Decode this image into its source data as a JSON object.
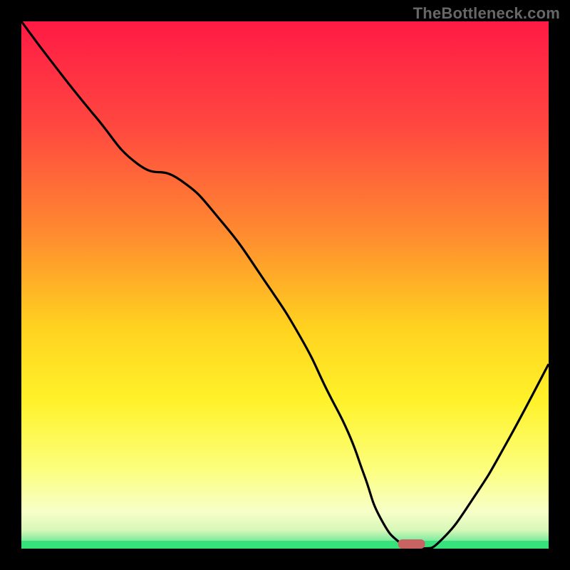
{
  "watermark": "TheBottleneck.com",
  "colors": {
    "bg": "#000000",
    "watermark": "#676767",
    "curve": "#000000",
    "marker_fill": "#c96263",
    "bottom_stripe": "#37e17c",
    "gradient_stops": [
      {
        "offset": 0.0,
        "color": "#ff1a45"
      },
      {
        "offset": 0.2,
        "color": "#ff4840"
      },
      {
        "offset": 0.4,
        "color": "#ff8a30"
      },
      {
        "offset": 0.58,
        "color": "#ffd21f"
      },
      {
        "offset": 0.72,
        "color": "#fff22a"
      },
      {
        "offset": 0.85,
        "color": "#fcff7e"
      },
      {
        "offset": 0.93,
        "color": "#f7ffc8"
      },
      {
        "offset": 0.965,
        "color": "#d7f7b8"
      },
      {
        "offset": 0.985,
        "color": "#7eeb9e"
      },
      {
        "offset": 1.0,
        "color": "#37e17c"
      }
    ]
  },
  "chart_data": {
    "type": "line",
    "title": "",
    "xlabel": "",
    "ylabel": "",
    "xlim": [
      0,
      100
    ],
    "ylim": [
      0,
      100
    ],
    "x": [
      0,
      6,
      14,
      22,
      30,
      38,
      46,
      53,
      58,
      62,
      65,
      68,
      72,
      76,
      80,
      86,
      92,
      100
    ],
    "values": [
      100,
      92,
      82,
      73,
      70,
      62,
      51,
      40,
      30,
      22,
      14,
      6,
      1,
      0,
      2,
      10,
      20,
      35
    ],
    "marker": {
      "x": 74,
      "y": 0
    },
    "annotations": []
  }
}
